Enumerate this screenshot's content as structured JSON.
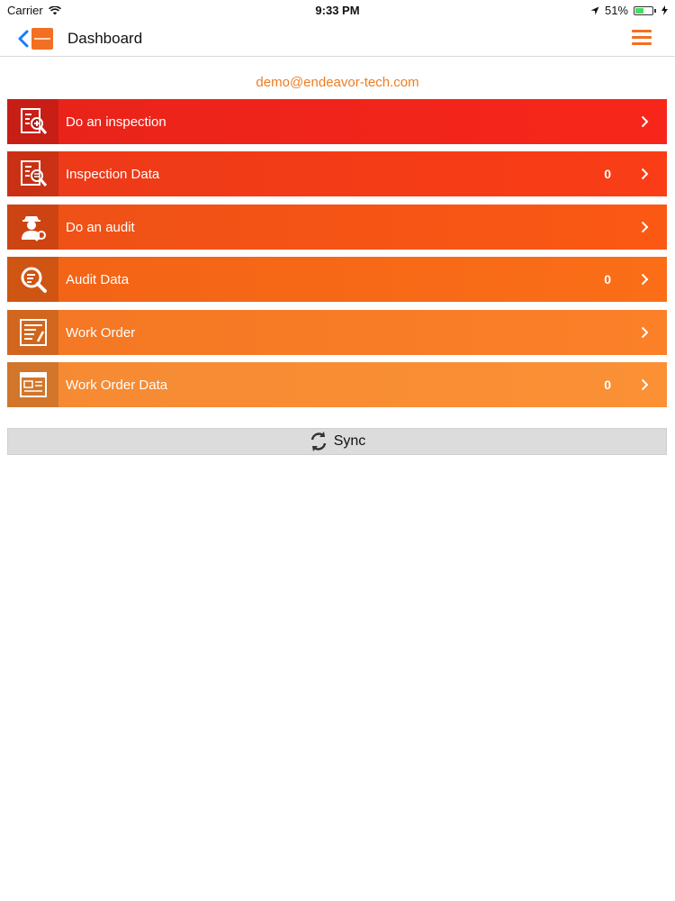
{
  "status_bar": {
    "carrier": "Carrier",
    "time": "9:33 PM",
    "battery": "51%",
    "battery_level": 0.51
  },
  "nav": {
    "title": "Dashboard",
    "back_icon": "chevron-left-icon",
    "menu_icon": "hamburger-menu-icon",
    "accent_color": "#f36f21"
  },
  "user": {
    "email": "demo@endeavor-tech.com"
  },
  "menu": {
    "items": [
      {
        "label": "Do an inspection",
        "count": "",
        "icon": "inspection-icon",
        "color_from": "#e8231a",
        "color_to": "#f8261a"
      },
      {
        "label": "Inspection Data",
        "count": "0",
        "icon": "inspection-data-icon",
        "color_from": "#ec3a18",
        "color_to": "#fa3d16"
      },
      {
        "label": "Do an audit",
        "count": "",
        "icon": "auditor-icon",
        "color_from": "#ee5016",
        "color_to": "#fb5814"
      },
      {
        "label": "Audit Data",
        "count": "0",
        "icon": "audit-data-icon",
        "color_from": "#f26316",
        "color_to": "#fb6e17"
      },
      {
        "label": "Work Order",
        "count": "",
        "icon": "work-order-icon",
        "color_from": "#f47723",
        "color_to": "#fb8028"
      },
      {
        "label": "Work Order Data",
        "count": "0",
        "icon": "work-order-data-icon",
        "color_from": "#f58a33",
        "color_to": "#fb9035"
      }
    ]
  },
  "sync": {
    "label": "Sync",
    "icon": "sync-icon"
  }
}
